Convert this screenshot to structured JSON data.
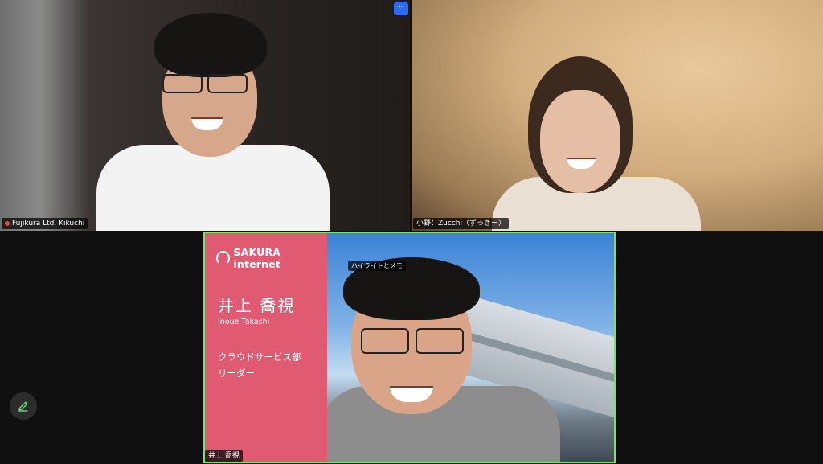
{
  "participants": [
    {
      "name": "Fujikura Ltd,  Kikuchi",
      "muted": true
    },
    {
      "name": "小野：Zucchi（ずっきー）"
    },
    {
      "name": "井上 喬視"
    }
  ],
  "more_button": {
    "label": "···"
  },
  "highlight_label": "ハイライトとメモ",
  "background_panel": {
    "logo_text": "SAKURA internet",
    "name_jp": "井上 喬視",
    "name_en": "Inoue Takashi",
    "department": "クラウドサービス部",
    "role": "リーダー"
  },
  "annotate_button": {
    "icon": "pencil-icon"
  },
  "colors": {
    "active_speaker_border": "#7ee06d",
    "sakura_pink": "#e05a72",
    "more_button_blue": "#2f6bf2",
    "pencil_green": "#6fd37a"
  }
}
